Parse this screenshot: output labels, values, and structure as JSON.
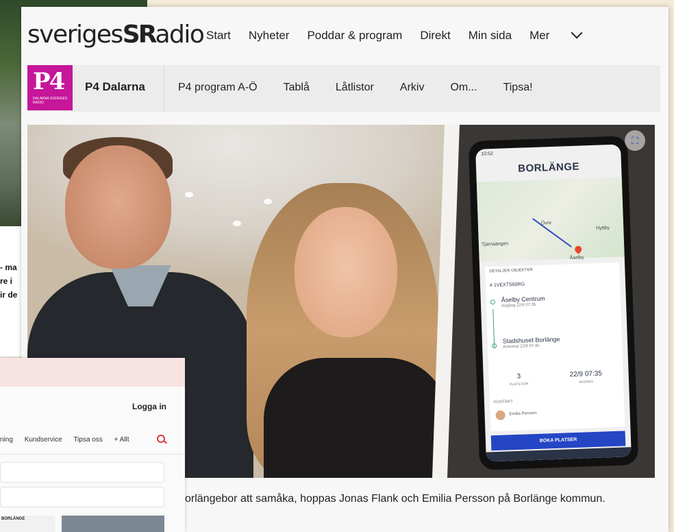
{
  "background": {
    "snippet_lines": [
      "ma -",
      "re i",
      "ir de"
    ]
  },
  "top_nav": {
    "logo_text": "sveriges",
    "logo_mark": "SR",
    "logo_tail": "adio",
    "links": [
      "Start",
      "Nyheter",
      "Poddar & program",
      "Direkt",
      "Min sida",
      "Mer"
    ]
  },
  "sub_nav": {
    "p4_logo": "P4",
    "p4_small": "DALARNA SVERIGES RADIO",
    "station": "P4 Dalarna",
    "links": [
      "P4 program A-Ö",
      "Tablå",
      "Låtlistor",
      "Arkiv",
      "Om...",
      "Tipsa!"
    ]
  },
  "phone_app": {
    "status": "10:52",
    "title": "BORLÄNGE",
    "map_labels": [
      "Övre",
      "Åselby",
      "Hyttby",
      "Tjärnaängen"
    ],
    "tabs": "DETALJER   OBJEKTER",
    "trip_no": "# 1VEXTS50RG",
    "stop1_name": "Åselby Centrum",
    "stop1_time": "Avgång 22/9 07:35",
    "stop2_name": "Stadshuset Borlänge",
    "stop2_time": "Ankomst 22/9 07:40",
    "seats_value": "3",
    "seats_label": "PLATS FÖR",
    "depart_value": "22/9 07:35",
    "depart_label": "AVGÅNG",
    "contact_label": "KONTAKT",
    "contact_name": "Emilia Persson",
    "book_button": "BOKA PLATSER"
  },
  "caption": "orlängebor att samåka, hoppas Jonas Flank och Emilia Persson på Borlänge kommun.",
  "overlay_card": {
    "login": "Logga in",
    "nav": [
      "ning",
      "Kundservice",
      "Tipsa oss",
      "+ Allt"
    ],
    "thumb_label": "BORLÄNGE"
  }
}
